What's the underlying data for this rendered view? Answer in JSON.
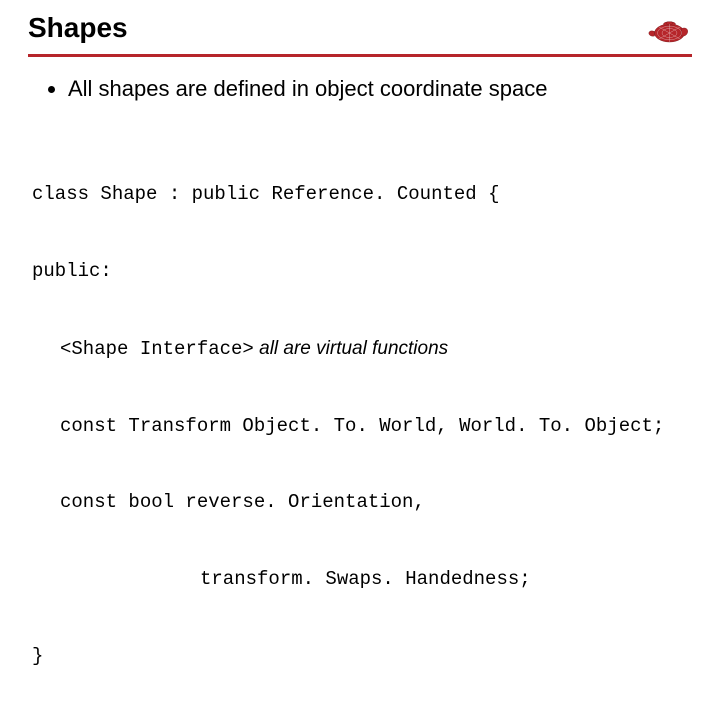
{
  "title": "Shapes",
  "bullet": "All shapes are defined in object coordinate space",
  "code": {
    "l1": "class Shape : public Reference. Counted {",
    "l2": "public:",
    "l3a": "<Shape Interface>",
    "l3b": " all are virtual functions",
    "l4": "const Transform Object. To. World, World. To. Object;",
    "l5": "const bool reverse. Orientation,",
    "l6": "transform. Swaps. Handedness;",
    "l7": "}"
  }
}
